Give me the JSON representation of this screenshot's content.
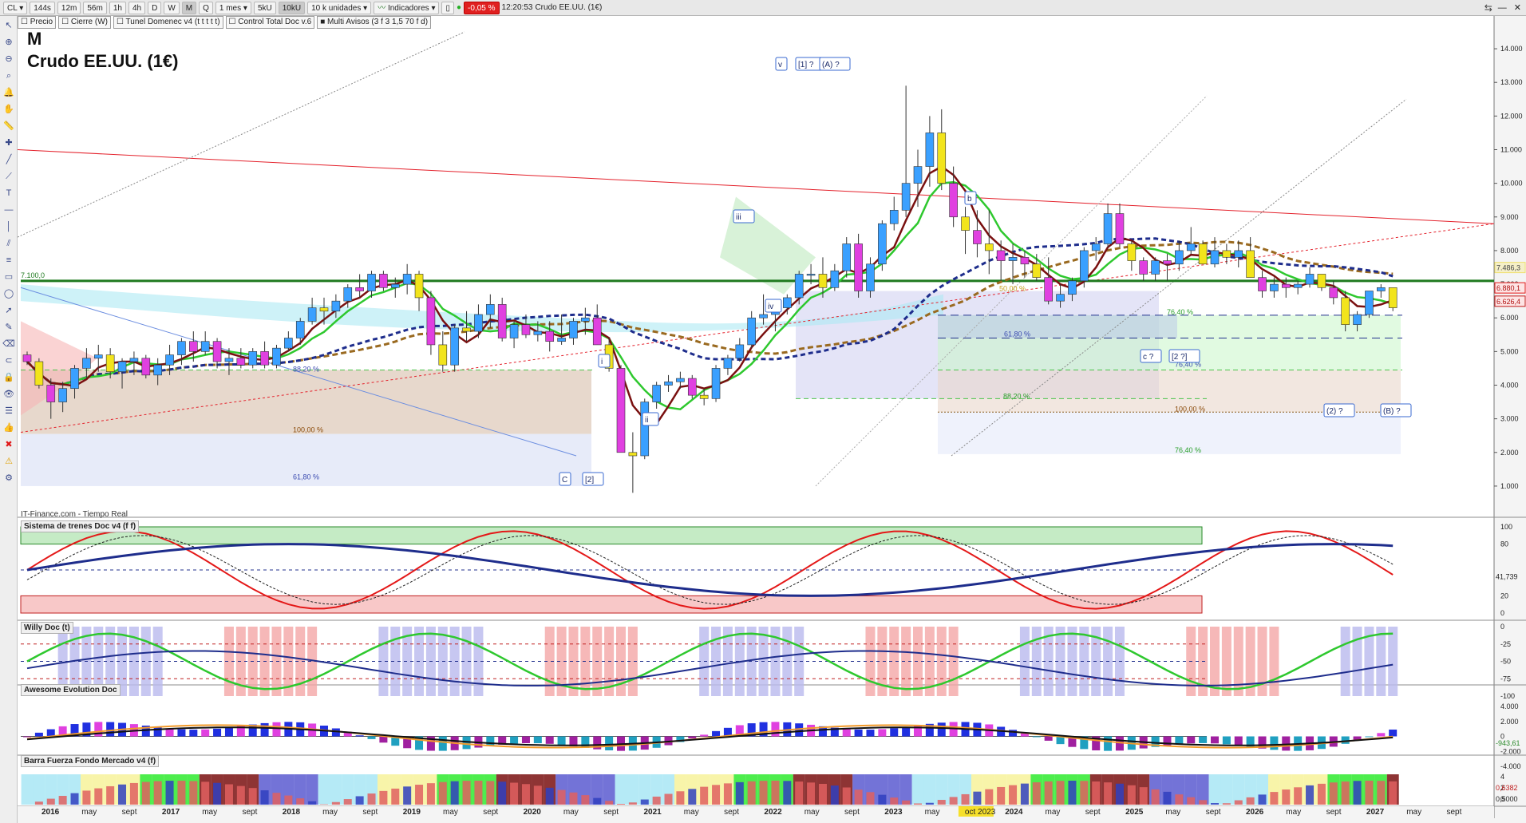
{
  "toolbar": {
    "symbol": "CL",
    "timeframes": [
      "144s",
      "12m",
      "56m",
      "1h",
      "4h",
      "D",
      "W",
      "M",
      "Q"
    ],
    "period": "1 mes",
    "units_a": "5kU",
    "units_b": "10kU",
    "units_select": "10 k unidades",
    "indicators": "Indicadores",
    "change": "-0,05 %",
    "time": "12:20:53",
    "instrument": "Crudo EE.UU. (1€)"
  },
  "indicators_bar": [
    "Precio",
    "Cierre (W)",
    "Tunel Domenec v4 (t t t t t)",
    "Control Total Doc v.6",
    "Multi Avisos (3 f 3 1,5 70 f d)"
  ],
  "header": {
    "timeframe": "M",
    "title": "Crudo EE.UU. (1€)"
  },
  "source": "IT-Finance.com - Tiempo Real",
  "panels": [
    "Sistema de trenes Doc v4 (f f)",
    "Willy Doc (t)",
    "Awesome Evolution Doc",
    "Barra Fuerza Fondo Mercado v4 (f)"
  ],
  "colors": {
    "bg": "#ffffff",
    "red": "#e4222c",
    "green": "#1a9c1a",
    "darkgreen": "#1f7a1f",
    "blue": "#1e2d8c",
    "brown": "#8a5a1a"
  },
  "chart_data": [
    {
      "type": "candlestick",
      "title": "Crudo EE.UU. (1€)",
      "ylim": [
        0.5,
        14.5
      ],
      "y_ticks": [
        "1.000",
        "2.000",
        "3.000",
        "4.000",
        "5.000",
        "6.000",
        "7.000",
        "8.000",
        "9.000",
        "10.000",
        "11.000",
        "12.000",
        "13.000",
        "14.000"
      ],
      "x_labels": [
        "2016",
        "may",
        "sept",
        "2017",
        "may",
        "sept",
        "2018",
        "may",
        "sept",
        "2019",
        "may",
        "sept",
        "2020",
        "may",
        "sept",
        "2021",
        "may",
        "sept",
        "2022",
        "may",
        "sept",
        "2023",
        "may",
        "oct 2023",
        "2024",
        "may",
        "sept",
        "2025",
        "may",
        "sept",
        "2026",
        "may",
        "sept",
        "2027",
        "may",
        "sept"
      ],
      "ohlc": [
        [
          4.9,
          5.0,
          4.6,
          4.7
        ],
        [
          4.7,
          4.8,
          3.9,
          4.0
        ],
        [
          4.0,
          4.2,
          3.0,
          3.5
        ],
        [
          3.5,
          4.1,
          3.2,
          3.9
        ],
        [
          3.9,
          4.6,
          3.6,
          4.5
        ],
        [
          4.5,
          5.1,
          4.2,
          4.8
        ],
        [
          4.8,
          5.2,
          4.4,
          4.9
        ],
        [
          4.9,
          5.1,
          4.2,
          4.4
        ],
        [
          4.4,
          4.8,
          3.9,
          4.7
        ],
        [
          4.7,
          5.0,
          4.3,
          4.8
        ],
        [
          4.8,
          4.9,
          4.2,
          4.3
        ],
        [
          4.3,
          4.8,
          4.0,
          4.6
        ],
        [
          4.6,
          5.2,
          4.3,
          4.9
        ],
        [
          4.9,
          5.4,
          4.6,
          5.3
        ],
        [
          5.3,
          5.6,
          4.7,
          5.0
        ],
        [
          5.0,
          5.6,
          4.9,
          5.3
        ],
        [
          5.3,
          5.4,
          4.5,
          4.7
        ],
        [
          4.7,
          5.1,
          4.3,
          4.8
        ],
        [
          4.8,
          5.1,
          4.5,
          4.6
        ],
        [
          4.6,
          5.1,
          4.5,
          5.0
        ],
        [
          5.0,
          5.3,
          4.5,
          4.6
        ],
        [
          4.6,
          5.2,
          4.5,
          5.1
        ],
        [
          5.1,
          5.6,
          5.0,
          5.4
        ],
        [
          5.4,
          6.0,
          5.2,
          5.9
        ],
        [
          5.9,
          6.6,
          5.8,
          6.3
        ],
        [
          6.3,
          6.6,
          5.8,
          6.2
        ],
        [
          6.2,
          6.7,
          6.0,
          6.5
        ],
        [
          6.5,
          7.0,
          6.3,
          6.9
        ],
        [
          6.9,
          7.3,
          6.6,
          6.8
        ],
        [
          6.8,
          7.4,
          6.6,
          7.3
        ],
        [
          7.3,
          7.4,
          6.8,
          6.9
        ],
        [
          6.9,
          7.2,
          6.6,
          7.0
        ],
        [
          7.0,
          7.6,
          6.7,
          7.3
        ],
        [
          7.3,
          7.4,
          6.2,
          6.6
        ],
        [
          6.6,
          6.8,
          4.9,
          5.2
        ],
        [
          5.2,
          5.6,
          4.4,
          4.6
        ],
        [
          4.6,
          5.8,
          4.4,
          5.7
        ],
        [
          5.7,
          6.2,
          5.3,
          5.6
        ],
        [
          5.6,
          6.4,
          5.4,
          6.1
        ],
        [
          6.1,
          6.7,
          5.7,
          6.4
        ],
        [
          6.4,
          6.6,
          5.3,
          5.4
        ],
        [
          5.4,
          5.9,
          5.1,
          5.8
        ],
        [
          5.8,
          6.1,
          5.4,
          5.5
        ],
        [
          5.5,
          5.9,
          5.3,
          5.6
        ],
        [
          5.6,
          5.9,
          5.0,
          5.3
        ],
        [
          5.3,
          6.1,
          5.2,
          5.4
        ],
        [
          5.4,
          6.0,
          5.2,
          5.9
        ],
        [
          5.9,
          6.3,
          5.5,
          6.0
        ],
        [
          6.0,
          6.4,
          5.2,
          5.2
        ],
        [
          5.2,
          5.4,
          4.4,
          4.5
        ],
        [
          4.5,
          4.6,
          2.0,
          2.0
        ],
        [
          2.0,
          2.6,
          0.8,
          1.9
        ],
        [
          1.9,
          3.6,
          1.8,
          3.5
        ],
        [
          3.5,
          4.1,
          3.3,
          4.0
        ],
        [
          4.0,
          4.3,
          3.8,
          4.1
        ],
        [
          4.1,
          4.4,
          3.9,
          4.2
        ],
        [
          4.2,
          4.3,
          3.6,
          3.7
        ],
        [
          3.7,
          3.9,
          3.4,
          3.6
        ],
        [
          3.6,
          4.6,
          3.5,
          4.5
        ],
        [
          4.5,
          4.9,
          4.3,
          4.8
        ],
        [
          4.8,
          5.4,
          4.7,
          5.2
        ],
        [
          5.2,
          6.2,
          5.1,
          6.0
        ],
        [
          6.0,
          6.7,
          5.8,
          6.1
        ],
        [
          6.1,
          6.5,
          5.6,
          6.3
        ],
        [
          6.3,
          6.7,
          6.1,
          6.6
        ],
        [
          6.6,
          7.4,
          6.4,
          7.3
        ],
        [
          7.3,
          7.6,
          7.0,
          7.3
        ],
        [
          7.3,
          7.8,
          6.6,
          6.9
        ],
        [
          6.9,
          7.6,
          6.8,
          7.4
        ],
        [
          7.4,
          8.4,
          7.2,
          8.2
        ],
        [
          8.2,
          8.5,
          6.6,
          6.8
        ],
        [
          6.8,
          7.8,
          6.6,
          7.6
        ],
        [
          7.6,
          8.9,
          7.4,
          8.8
        ],
        [
          8.8,
          9.6,
          8.6,
          9.2
        ],
        [
          9.2,
          12.9,
          9.0,
          10.0
        ],
        [
          10.0,
          11.0,
          9.3,
          10.5
        ],
        [
          10.5,
          12.0,
          9.9,
          11.5
        ],
        [
          11.5,
          12.2,
          9.8,
          10.0
        ],
        [
          10.0,
          10.5,
          8.7,
          9.0
        ],
        [
          9.0,
          9.3,
          7.9,
          8.6
        ],
        [
          8.6,
          9.2,
          7.8,
          8.2
        ],
        [
          8.2,
          9.2,
          7.3,
          8.0
        ],
        [
          8.0,
          8.3,
          7.1,
          7.7
        ],
        [
          7.7,
          8.2,
          7.0,
          7.8
        ],
        [
          7.8,
          8.0,
          7.2,
          7.6
        ],
        [
          7.6,
          7.9,
          7.1,
          7.2
        ],
        [
          7.2,
          7.8,
          6.4,
          6.5
        ],
        [
          6.5,
          7.0,
          6.3,
          6.7
        ],
        [
          6.7,
          7.2,
          6.5,
          7.1
        ],
        [
          7.1,
          8.1,
          6.9,
          8.0
        ],
        [
          8.0,
          8.4,
          7.7,
          8.2
        ],
        [
          8.2,
          9.4,
          8.1,
          9.1
        ],
        [
          9.1,
          9.4,
          8.1,
          8.2
        ],
        [
          8.2,
          8.3,
          7.4,
          7.7
        ],
        [
          7.7,
          7.8,
          7.1,
          7.3
        ],
        [
          7.3,
          7.8,
          7.1,
          7.7
        ],
        [
          7.7,
          7.9,
          7.1,
          7.6
        ],
        [
          7.6,
          8.3,
          7.4,
          8.0
        ],
        [
          8.0,
          8.7,
          7.9,
          8.2
        ],
        [
          8.2,
          8.3,
          7.6,
          7.6
        ],
        [
          7.6,
          8.4,
          7.5,
          8.0
        ],
        [
          8.0,
          8.2,
          7.6,
          7.8
        ],
        [
          7.8,
          8.3,
          7.5,
          8.0
        ],
        [
          8.0,
          8.4,
          7.2,
          7.2
        ],
        [
          7.2,
          7.4,
          6.6,
          6.8
        ],
        [
          6.8,
          7.2,
          6.6,
          7.0
        ],
        [
          7.0,
          7.2,
          6.6,
          6.9
        ],
        [
          6.9,
          7.1,
          6.7,
          7.0
        ],
        [
          7.0,
          7.5,
          6.9,
          7.3
        ],
        [
          7.3,
          7.3,
          6.8,
          6.9
        ],
        [
          6.9,
          7.1,
          6.4,
          6.6
        ],
        [
          6.6,
          6.8,
          5.6,
          5.8
        ],
        [
          5.8,
          6.2,
          5.6,
          6.1
        ],
        [
          6.1,
          6.8,
          6.0,
          6.8
        ],
        [
          6.8,
          7.0,
          6.6,
          6.9
        ],
        [
          6.9,
          6.9,
          6.2,
          6.3
        ]
      ],
      "horizontal_lines": [
        {
          "label": "7.100,0",
          "value": 7.1
        }
      ],
      "price_labels": [
        {
          "text": "7.486,3",
          "value": 7.486
        },
        {
          "text": "6.880,1",
          "value": 6.88
        },
        {
          "text": "6.626,4",
          "value": 6.626
        }
      ],
      "fib_labels": [
        "50,00 %",
        "61,80 %",
        "76,40 %",
        "88,20 %",
        "100,00 %",
        "76,40 %",
        "88,20 %",
        "100,00 %",
        "61,80 %",
        "76,40 %"
      ],
      "wave_labels": [
        "v",
        "[1] ?",
        "(A) ?",
        "iii",
        "iv",
        "b",
        "c ?",
        "[2 ?]",
        "i",
        "ii",
        "C",
        "[2]",
        "(2) ?",
        "(B) ?"
      ]
    },
    {
      "type": "line",
      "title": "Sistema de trenes Doc v4 (f f)",
      "ylim": [
        0,
        100
      ],
      "y_ticks": [
        "100",
        "80",
        "20",
        "0"
      ],
      "value_labels": [
        "41,739"
      ]
    },
    {
      "type": "line",
      "title": "Willy Doc (t)",
      "ylim": [
        -100,
        0
      ],
      "y_ticks": [
        "0",
        "-25",
        "-50",
        "-75",
        "-100"
      ]
    },
    {
      "type": "bar",
      "title": "Awesome Evolution Doc",
      "ylim": [
        -4000,
        4000
      ],
      "y_ticks": [
        "4.000",
        "2.000",
        "0",
        "-2.000",
        "-4.000"
      ],
      "value_labels": [
        "-943,61"
      ]
    },
    {
      "type": "bar",
      "title": "Barra Fuerza Fondo Mercado v4 (f)",
      "y_ticks": [
        "4",
        "2",
        "0"
      ],
      "value_labels": [
        "0,6382",
        "0,5000"
      ]
    }
  ]
}
